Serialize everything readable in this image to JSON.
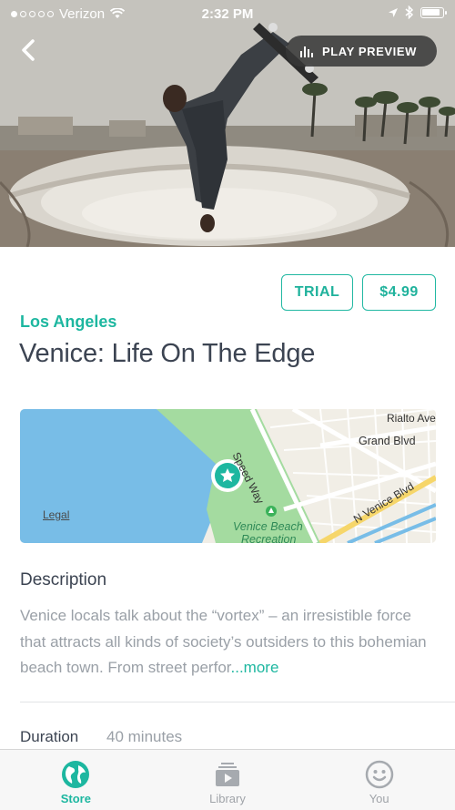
{
  "status_bar": {
    "carrier": "Verizon",
    "time": "2:32 PM"
  },
  "hero": {
    "play_preview_label": "PLAY PREVIEW"
  },
  "pricing": {
    "trial_label": "TRIAL",
    "price_label": "$4.99"
  },
  "tour": {
    "city": "Los Angeles",
    "title": "Venice: Life On The Edge"
  },
  "map": {
    "legal_label": "Legal",
    "streets": [
      "Rialto Ave",
      "Grand Blvd",
      "Speed Way",
      "N Venice Blvd"
    ],
    "poi_lines": [
      "Venice Beach",
      "Recreation"
    ]
  },
  "description": {
    "heading": "Description",
    "text": "Venice locals talk about the “vortex” – an irresistible force that attracts all kinds of society’s outsiders to this bohemian beach town. From street perfor",
    "more_label": "...more"
  },
  "details": {
    "duration_label": "Duration",
    "duration_value": "40 minutes"
  },
  "tab_bar": {
    "tabs": [
      {
        "label": "Store"
      },
      {
        "label": "Library"
      },
      {
        "label": "You"
      }
    ]
  },
  "colors": {
    "accent": "#1db7a0",
    "title_text": "#3c4452",
    "muted_text": "#9aa0a7"
  }
}
